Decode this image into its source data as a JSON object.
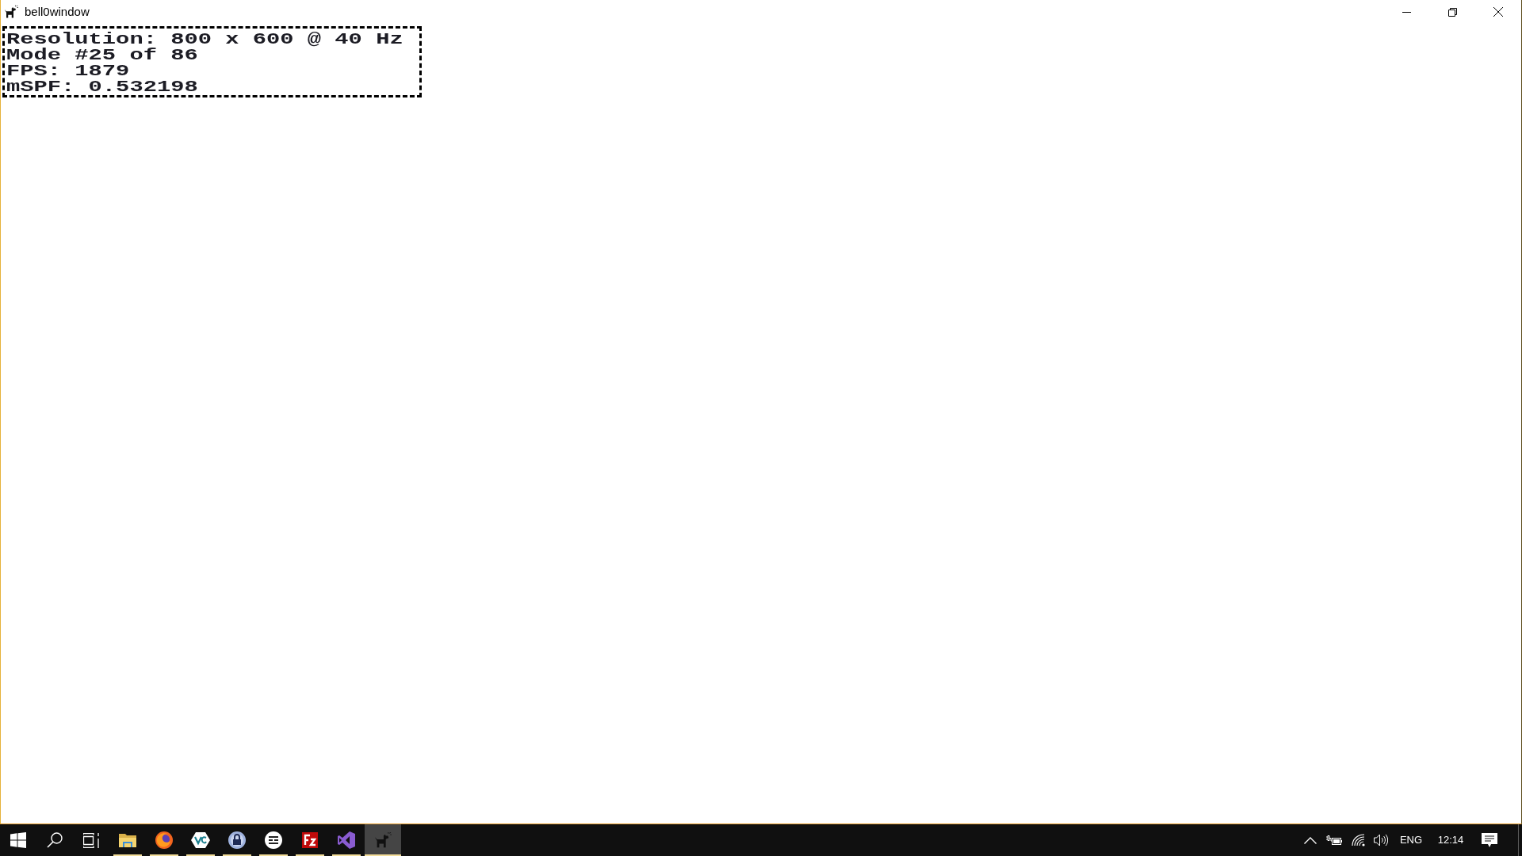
{
  "window": {
    "title": "bell0window"
  },
  "stats_panel": {
    "lines": [
      "Resolution: 800 x 600 @ 40 Hz",
      "Mode #25 of 86",
      "FPS: 1879",
      "mSPF: 0.532198"
    ]
  },
  "taskbar": {
    "apps": [
      {
        "kind": "files",
        "running": true,
        "selected": false
      },
      {
        "kind": "browser",
        "running": true,
        "selected": false
      },
      {
        "kind": "hexagon",
        "running": true,
        "selected": false
      },
      {
        "kind": "padlock",
        "running": true,
        "selected": false
      },
      {
        "kind": "feed",
        "running": true,
        "selected": false
      },
      {
        "kind": "tile",
        "running": true,
        "selected": false
      },
      {
        "kind": "ribbon",
        "running": true,
        "selected": false
      },
      {
        "kind": "dog",
        "running": true,
        "selected": true
      }
    ],
    "tray": {
      "language": "ENG",
      "time": "12:14"
    }
  }
}
